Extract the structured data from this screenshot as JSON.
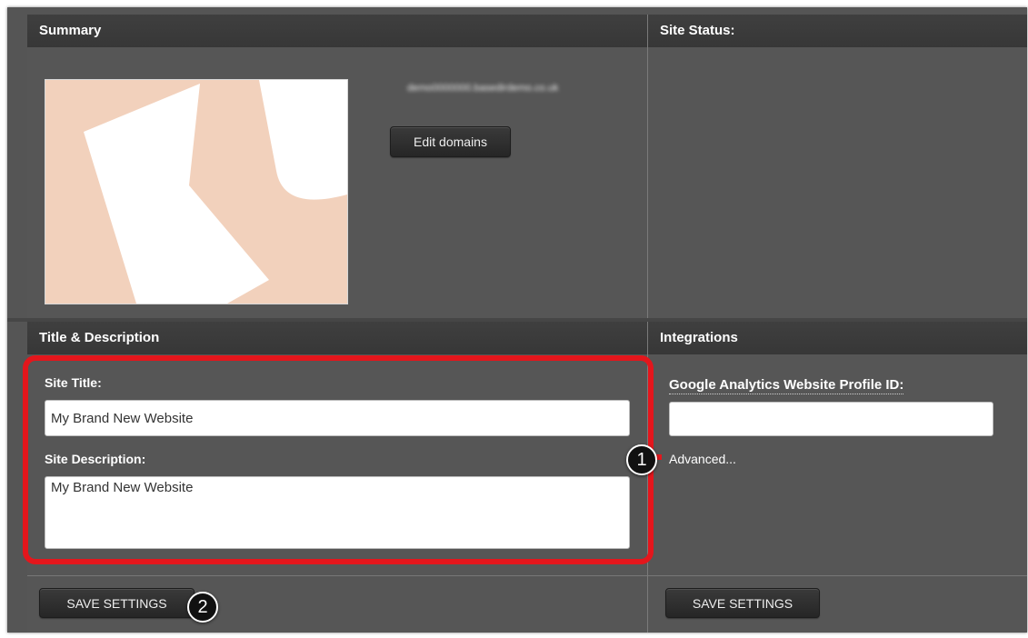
{
  "summary": {
    "header": "Summary",
    "domain_blurred": "demo0000000.basedirdemo.co.uk",
    "edit_domains_label": "Edit domains"
  },
  "site_status": {
    "header": "Site Status:"
  },
  "title_description": {
    "header": "Title & Description",
    "site_title_label": "Site Title:",
    "site_title_value": "My Brand New Website",
    "site_description_label": "Site Description:",
    "site_description_value": "My Brand New Website",
    "save_label": "SAVE SETTINGS"
  },
  "integrations": {
    "header": "Integrations",
    "ga_label": "Google Analytics Website Profile ID:",
    "ga_value": "",
    "advanced_link": "Advanced...",
    "save_label": "SAVE SETTINGS"
  },
  "callouts": {
    "first": "1",
    "second": "2"
  },
  "colors": {
    "highlight": "#e4161c",
    "panel": "#565656",
    "header": "#3a3a3a",
    "thumbnail_shape": "#f2d1bc"
  }
}
